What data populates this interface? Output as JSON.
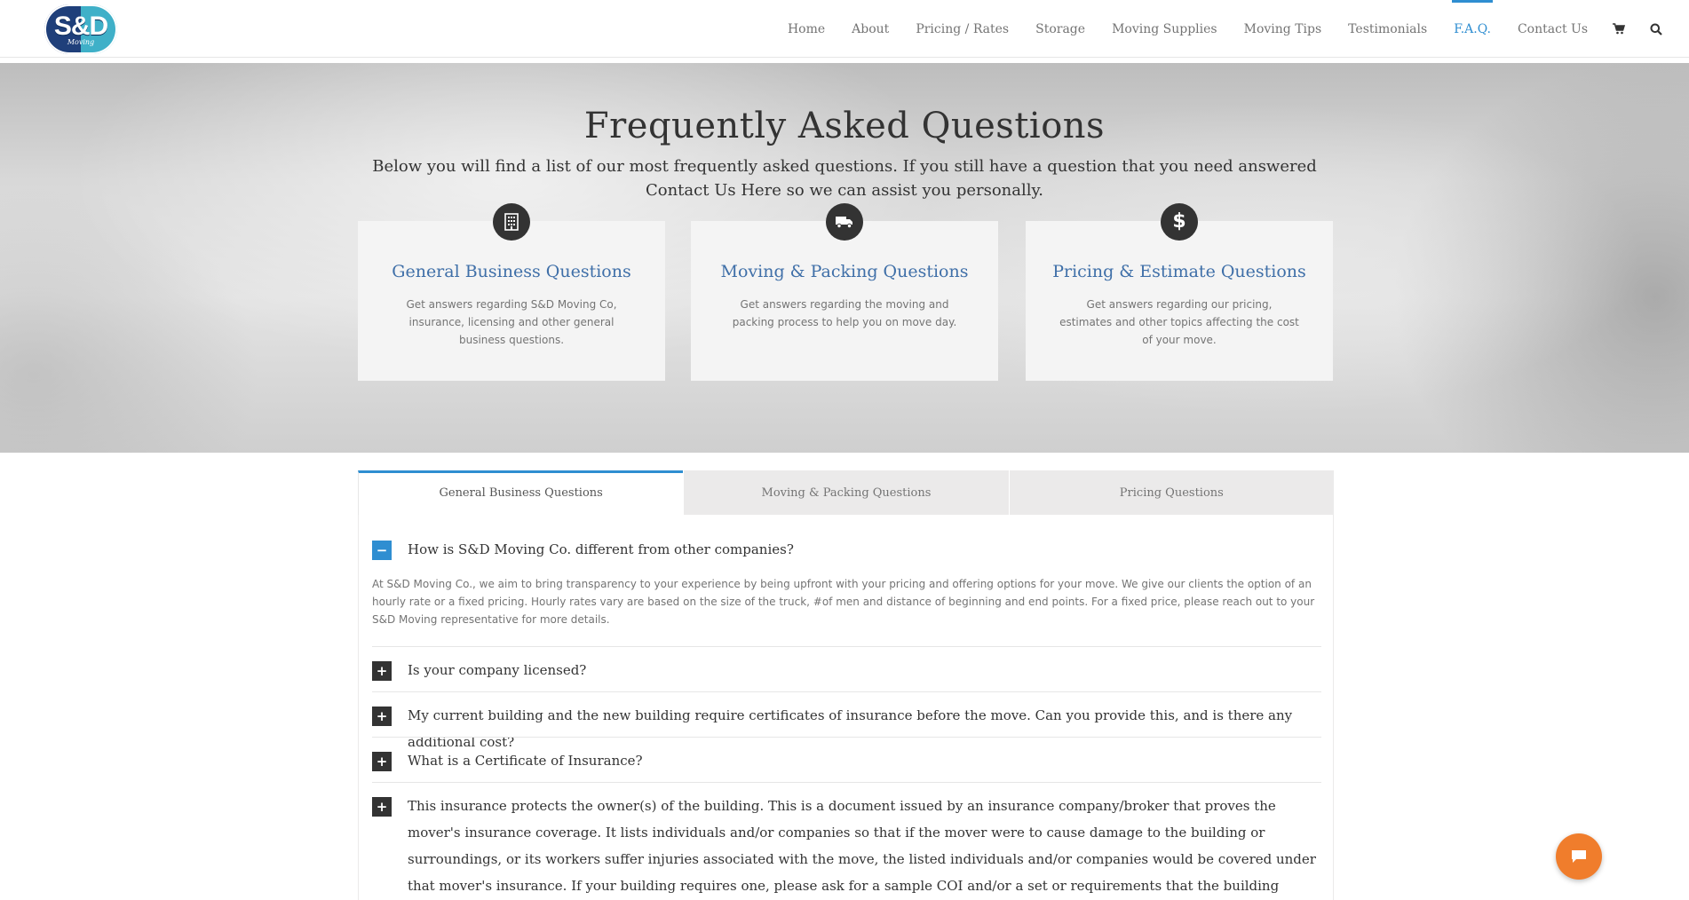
{
  "brand": {
    "logo_text": "S&D",
    "logo_sub": "Moving"
  },
  "nav": {
    "items": [
      "Home",
      "About",
      "Pricing / Rates",
      "Storage",
      "Moving Supplies",
      "Moving Tips",
      "Testimonials",
      "F.A.Q.",
      "Contact Us"
    ],
    "active": "F.A.Q.",
    "icons": [
      "cart-icon",
      "search-icon"
    ]
  },
  "hero": {
    "title": "Frequently Asked Questions",
    "subtitle": "Below you will find a list of our most frequently asked questions. If you still have a question that you need answered Contact Us Here so we can assist you personally."
  },
  "cards": [
    {
      "icon": "building-icon",
      "title": "General Business Questions",
      "desc": "Get answers regarding S&D Moving Co, insurance, licensing and other general business questions."
    },
    {
      "icon": "truck-icon",
      "title": "Moving & Packing Questions",
      "desc": "Get answers regarding the moving and packing process to help you on move day."
    },
    {
      "icon": "dollar-icon",
      "title": "Pricing & Estimate Questions",
      "desc": "Get answers regarding our pricing, estimates and other topics affecting the cost of your move."
    }
  ],
  "tabs": [
    "General Business Questions",
    "Moving & Packing Questions",
    "Pricing Questions"
  ],
  "active_tab": "General Business Questions",
  "faqs": [
    {
      "q": "How is S&D Moving Co. different from other companies?",
      "open": true,
      "toggle": "−",
      "a": "At S&D Moving Co., we aim to bring transparency to your experience by being upfront with your pricing and offering options for your move. We give our clients the option of an hourly rate or a fixed pricing. Hourly rates vary are based on the size of the truck, #of men and distance of beginning and end points. For a fixed price, please reach out to your S&D Moving representative for more details."
    },
    {
      "q": "Is your company licensed?",
      "open": false,
      "toggle": "+"
    },
    {
      "q": "My current building and the new building require certificates of insurance before the move. Can you provide this, and is there any additional cost?",
      "open": false,
      "toggle": "+"
    },
    {
      "q": "What is a Certificate of Insurance?",
      "open": false,
      "toggle": "+"
    },
    {
      "q": "This insurance protects the owner(s) of the building. This is a document issued by an insurance company/broker that proves the mover's insurance coverage. It lists individuals and/or companies so that if the mover were to cause damage to the building or surroundings, or its workers suffer injuries associated with the move, the listed individuals and/or companies would be covered under that mover's insurance. If your building requires one, please ask for a sample COI and/or a set or requirements that the building wants listed on the document. Once you receive it, please forward",
      "open": false,
      "toggle": "+"
    }
  ],
  "chat": {
    "icon": "chat-icon"
  },
  "colors": {
    "accent": "#2f8ed1",
    "card_title": "#3f6fa8",
    "chat": "#f07d2c",
    "dark": "#333333"
  }
}
